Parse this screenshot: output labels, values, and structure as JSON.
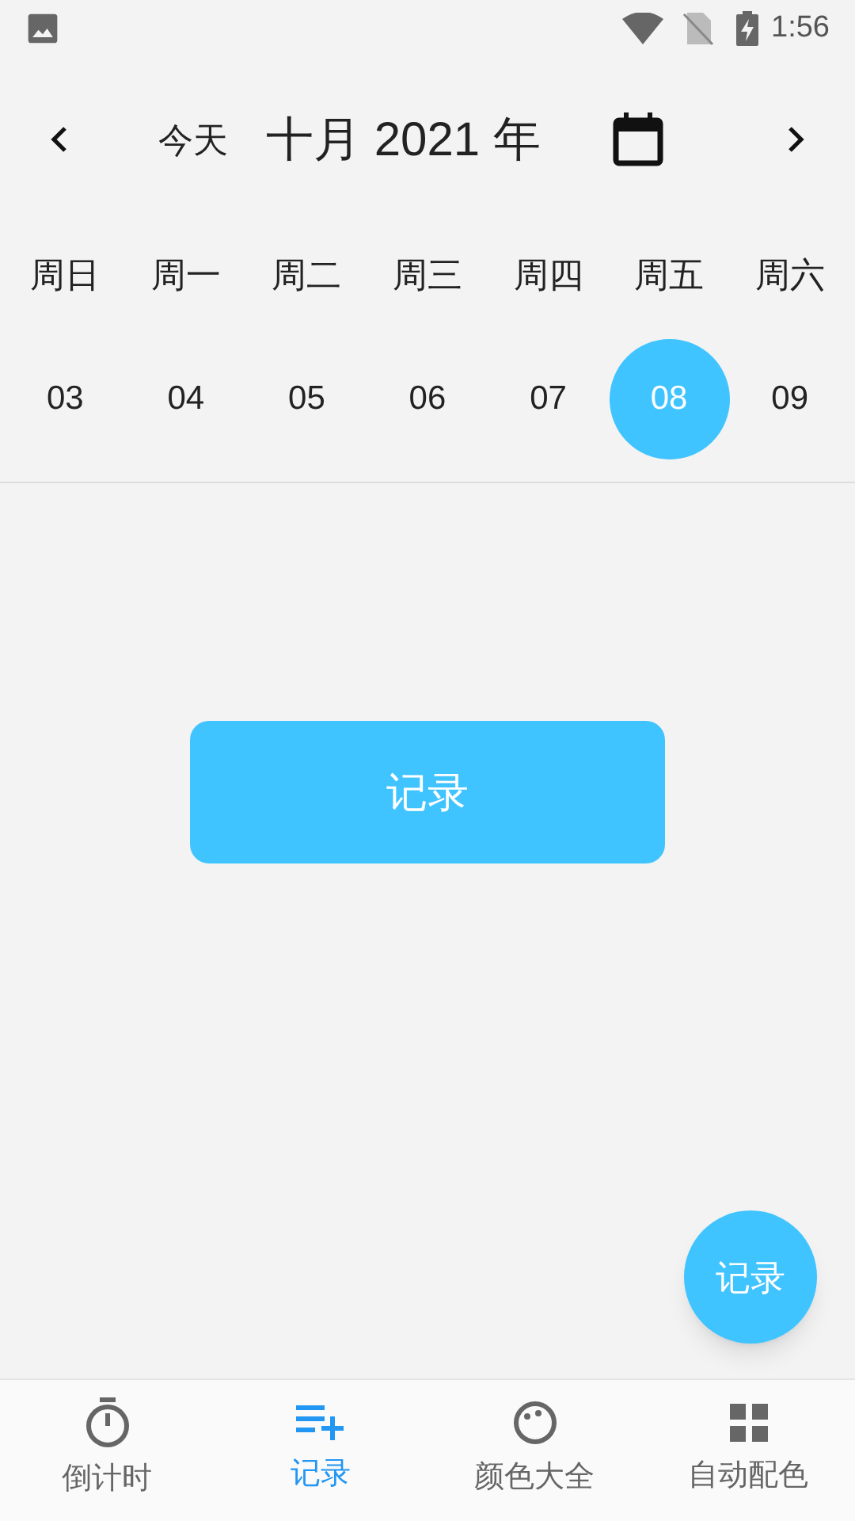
{
  "status_bar": {
    "time": "1:56"
  },
  "header": {
    "today": "今天",
    "month_title": "十月 2021 年"
  },
  "week": [
    {
      "weekday": "周日",
      "day": "03",
      "selected": false
    },
    {
      "weekday": "周一",
      "day": "04",
      "selected": false
    },
    {
      "weekday": "周二",
      "day": "05",
      "selected": false
    },
    {
      "weekday": "周三",
      "day": "06",
      "selected": false
    },
    {
      "weekday": "周四",
      "day": "07",
      "selected": false
    },
    {
      "weekday": "周五",
      "day": "08",
      "selected": true
    },
    {
      "weekday": "周六",
      "day": "09",
      "selected": false
    }
  ],
  "record_button": "记录",
  "fab": "记录",
  "bottom_nav": [
    {
      "label": "倒计时",
      "kind": "timer",
      "selected": false
    },
    {
      "label": "记录",
      "kind": "list-add",
      "selected": true
    },
    {
      "label": "颜色大全",
      "kind": "palette",
      "selected": false
    },
    {
      "label": "自动配色",
      "kind": "grid",
      "selected": false
    }
  ]
}
